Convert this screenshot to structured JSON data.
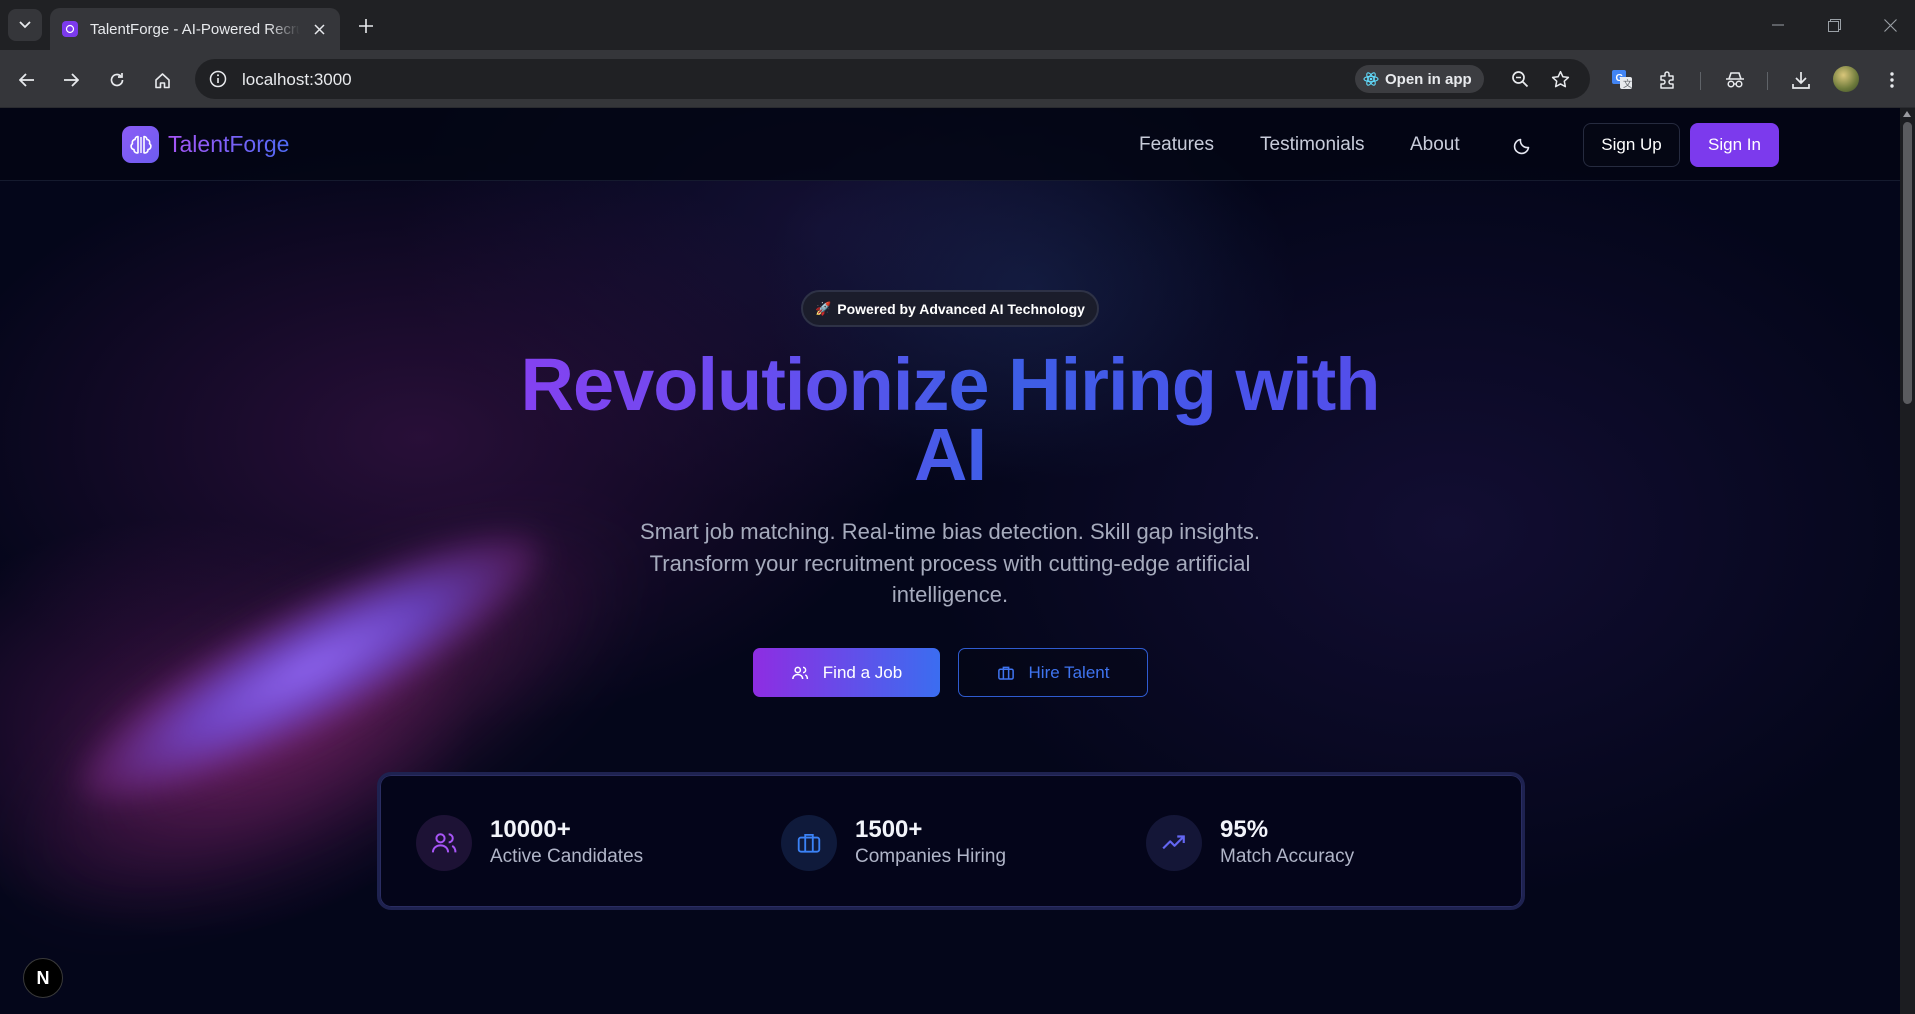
{
  "browser": {
    "tab_title": "TalentForge - AI-Powered Recruitment",
    "url": "localhost:3000",
    "open_in_app_label": "Open in app"
  },
  "nav": {
    "brand": "TalentForge",
    "links": [
      "Features",
      "Testimonials",
      "About"
    ],
    "sign_up": "Sign Up",
    "sign_in": "Sign In"
  },
  "hero": {
    "badge_emoji": "🚀",
    "badge": "Powered by Advanced AI Technology",
    "title_line1": "Revolutionize Hiring with",
    "title_line2": "AI",
    "subtitle": "Smart job matching. Real-time bias detection. Skill gap insights. Transform your recruitment process with cutting-edge artificial intelligence.",
    "primary_cta": "Find a Job",
    "secondary_cta": "Hire Talent"
  },
  "stats": [
    {
      "value": "10000+",
      "label": "Active Candidates",
      "icon": "users-icon",
      "color": "#a855f7"
    },
    {
      "value": "1500+",
      "label": "Companies Hiring",
      "icon": "briefcase-icon",
      "color": "#3b82f6"
    },
    {
      "value": "95%",
      "label": "Match Accuracy",
      "icon": "trending-up-icon",
      "color": "#6366f1"
    }
  ],
  "dev_badge": "N",
  "colors": {
    "accent": "#7c3aed",
    "blue": "#3b6df0",
    "background": "#04061a"
  }
}
